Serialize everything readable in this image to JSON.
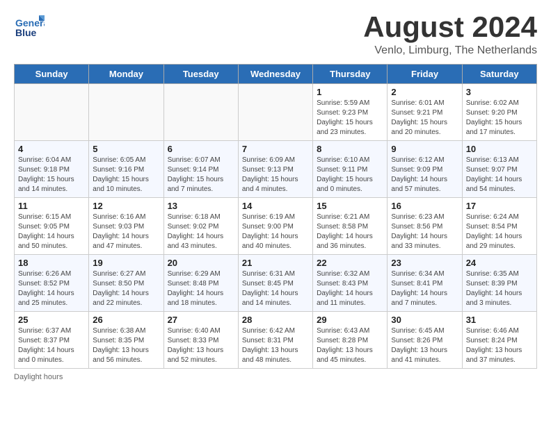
{
  "header": {
    "logo_line1": "General",
    "logo_line2": "Blue",
    "month_title": "August 2024",
    "location": "Venlo, Limburg, The Netherlands"
  },
  "weekdays": [
    "Sunday",
    "Monday",
    "Tuesday",
    "Wednesday",
    "Thursday",
    "Friday",
    "Saturday"
  ],
  "weeks": [
    [
      {
        "day": "",
        "info": ""
      },
      {
        "day": "",
        "info": ""
      },
      {
        "day": "",
        "info": ""
      },
      {
        "day": "",
        "info": ""
      },
      {
        "day": "1",
        "info": "Sunrise: 5:59 AM\nSunset: 9:23 PM\nDaylight: 15 hours\nand 23 minutes."
      },
      {
        "day": "2",
        "info": "Sunrise: 6:01 AM\nSunset: 9:21 PM\nDaylight: 15 hours\nand 20 minutes."
      },
      {
        "day": "3",
        "info": "Sunrise: 6:02 AM\nSunset: 9:20 PM\nDaylight: 15 hours\nand 17 minutes."
      }
    ],
    [
      {
        "day": "4",
        "info": "Sunrise: 6:04 AM\nSunset: 9:18 PM\nDaylight: 15 hours\nand 14 minutes."
      },
      {
        "day": "5",
        "info": "Sunrise: 6:05 AM\nSunset: 9:16 PM\nDaylight: 15 hours\nand 10 minutes."
      },
      {
        "day": "6",
        "info": "Sunrise: 6:07 AM\nSunset: 9:14 PM\nDaylight: 15 hours\nand 7 minutes."
      },
      {
        "day": "7",
        "info": "Sunrise: 6:09 AM\nSunset: 9:13 PM\nDaylight: 15 hours\nand 4 minutes."
      },
      {
        "day": "8",
        "info": "Sunrise: 6:10 AM\nSunset: 9:11 PM\nDaylight: 15 hours\nand 0 minutes."
      },
      {
        "day": "9",
        "info": "Sunrise: 6:12 AM\nSunset: 9:09 PM\nDaylight: 14 hours\nand 57 minutes."
      },
      {
        "day": "10",
        "info": "Sunrise: 6:13 AM\nSunset: 9:07 PM\nDaylight: 14 hours\nand 54 minutes."
      }
    ],
    [
      {
        "day": "11",
        "info": "Sunrise: 6:15 AM\nSunset: 9:05 PM\nDaylight: 14 hours\nand 50 minutes."
      },
      {
        "day": "12",
        "info": "Sunrise: 6:16 AM\nSunset: 9:03 PM\nDaylight: 14 hours\nand 47 minutes."
      },
      {
        "day": "13",
        "info": "Sunrise: 6:18 AM\nSunset: 9:02 PM\nDaylight: 14 hours\nand 43 minutes."
      },
      {
        "day": "14",
        "info": "Sunrise: 6:19 AM\nSunset: 9:00 PM\nDaylight: 14 hours\nand 40 minutes."
      },
      {
        "day": "15",
        "info": "Sunrise: 6:21 AM\nSunset: 8:58 PM\nDaylight: 14 hours\nand 36 minutes."
      },
      {
        "day": "16",
        "info": "Sunrise: 6:23 AM\nSunset: 8:56 PM\nDaylight: 14 hours\nand 33 minutes."
      },
      {
        "day": "17",
        "info": "Sunrise: 6:24 AM\nSunset: 8:54 PM\nDaylight: 14 hours\nand 29 minutes."
      }
    ],
    [
      {
        "day": "18",
        "info": "Sunrise: 6:26 AM\nSunset: 8:52 PM\nDaylight: 14 hours\nand 25 minutes."
      },
      {
        "day": "19",
        "info": "Sunrise: 6:27 AM\nSunset: 8:50 PM\nDaylight: 14 hours\nand 22 minutes."
      },
      {
        "day": "20",
        "info": "Sunrise: 6:29 AM\nSunset: 8:48 PM\nDaylight: 14 hours\nand 18 minutes."
      },
      {
        "day": "21",
        "info": "Sunrise: 6:31 AM\nSunset: 8:45 PM\nDaylight: 14 hours\nand 14 minutes."
      },
      {
        "day": "22",
        "info": "Sunrise: 6:32 AM\nSunset: 8:43 PM\nDaylight: 14 hours\nand 11 minutes."
      },
      {
        "day": "23",
        "info": "Sunrise: 6:34 AM\nSunset: 8:41 PM\nDaylight: 14 hours\nand 7 minutes."
      },
      {
        "day": "24",
        "info": "Sunrise: 6:35 AM\nSunset: 8:39 PM\nDaylight: 14 hours\nand 3 minutes."
      }
    ],
    [
      {
        "day": "25",
        "info": "Sunrise: 6:37 AM\nSunset: 8:37 PM\nDaylight: 14 hours\nand 0 minutes."
      },
      {
        "day": "26",
        "info": "Sunrise: 6:38 AM\nSunset: 8:35 PM\nDaylight: 13 hours\nand 56 minutes."
      },
      {
        "day": "27",
        "info": "Sunrise: 6:40 AM\nSunset: 8:33 PM\nDaylight: 13 hours\nand 52 minutes."
      },
      {
        "day": "28",
        "info": "Sunrise: 6:42 AM\nSunset: 8:31 PM\nDaylight: 13 hours\nand 48 minutes."
      },
      {
        "day": "29",
        "info": "Sunrise: 6:43 AM\nSunset: 8:28 PM\nDaylight: 13 hours\nand 45 minutes."
      },
      {
        "day": "30",
        "info": "Sunrise: 6:45 AM\nSunset: 8:26 PM\nDaylight: 13 hours\nand 41 minutes."
      },
      {
        "day": "31",
        "info": "Sunrise: 6:46 AM\nSunset: 8:24 PM\nDaylight: 13 hours\nand 37 minutes."
      }
    ]
  ],
  "footer": "Daylight hours"
}
